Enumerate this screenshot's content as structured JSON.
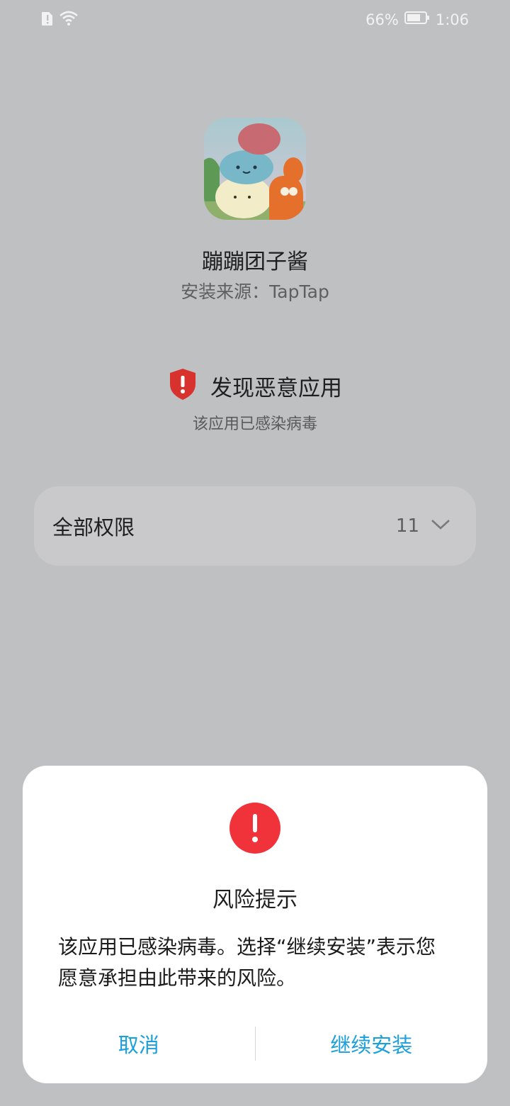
{
  "status_bar": {
    "battery_percent": "66%",
    "time": "1:06"
  },
  "app": {
    "name": "蹦蹦团子酱",
    "install_source": "安装来源：TapTap"
  },
  "warning": {
    "title": "发现恶意应用",
    "subtitle": "该应用已感染病毒"
  },
  "permissions": {
    "label": "全部权限",
    "count": "11"
  },
  "dialog": {
    "title": "风险提示",
    "message": "该应用已感染病毒。选择“继续安装”表示您愿意承担由此带来的风险。",
    "cancel_label": "取消",
    "continue_label": "继续安装"
  },
  "colors": {
    "background": "#bfc0c2",
    "accent_blue": "#1aa0dd",
    "danger_red": "#f0323a",
    "shield_red": "#d8322f"
  }
}
